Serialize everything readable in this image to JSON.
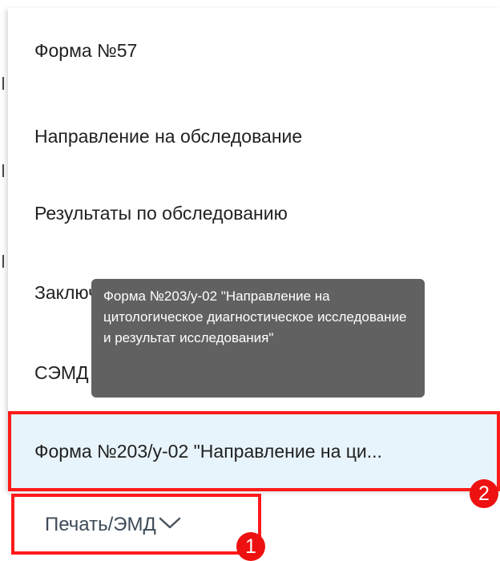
{
  "menu": {
    "items": [
      {
        "label": "Форма №57"
      },
      {
        "label": "Направление на обследование"
      },
      {
        "label": "Результаты по обследованию"
      },
      {
        "label": "Заключение"
      },
      {
        "label": "СЭМД Направление на госпитализац..."
      },
      {
        "label": "Форма №203/у-02 \"Направление на ци..."
      }
    ]
  },
  "tooltip": {
    "text": "Форма №203/у-02 \"Направление на цитологическое диагностическое исследование и результат исследования\""
  },
  "print_button": {
    "label": "Печать/ЭМД",
    "icon": "chevron-down-icon"
  },
  "annotations": {
    "badge_1": "1",
    "badge_2": "2"
  },
  "colors": {
    "annotation": "#ff1a1a",
    "tooltip": "#616161",
    "highlight": "#e8f4fb"
  }
}
